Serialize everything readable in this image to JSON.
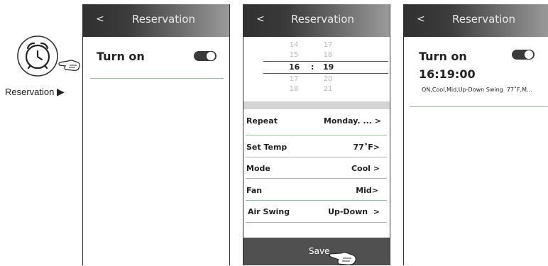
{
  "left": {
    "caption": "Reservation",
    "arrow": "▶"
  },
  "screen1": {
    "back": "<",
    "title": "Reservation",
    "turn_on_label": "Turn on",
    "toggle_on": true
  },
  "screen2": {
    "back": "<",
    "title": "Reservation",
    "picker": {
      "hours_above": [
        "14",
        "15"
      ],
      "hour_selected": "16",
      "hours_below": [
        "17",
        "18"
      ],
      "minutes_above": [
        "17",
        "18"
      ],
      "minute_selected": "19",
      "minutes_below": [
        "20",
        "21"
      ],
      "separator": ":"
    },
    "rows": [
      {
        "label": "Repeat",
        "value": "Monday. ... >"
      },
      {
        "label": "Set Temp",
        "value": "77˚F>"
      },
      {
        "label": "Mode",
        "value": "Cool >"
      },
      {
        "label": "Fan",
        "value": "Mid>"
      },
      {
        "label": "Air Swing",
        "value": "Up-Down  >"
      }
    ],
    "save_label": "Save"
  },
  "screen3": {
    "back": "<",
    "title": "Reservation",
    "turn_on_label": "Turn on",
    "toggle_on": true,
    "time": "16:19:00",
    "summary": "ON,Cool,Mid,Up-Down Swing  77˚F,M..."
  },
  "colors": {
    "header_dark": "#303030",
    "divider": "#9fb8a8",
    "save_bar": "#505050"
  }
}
